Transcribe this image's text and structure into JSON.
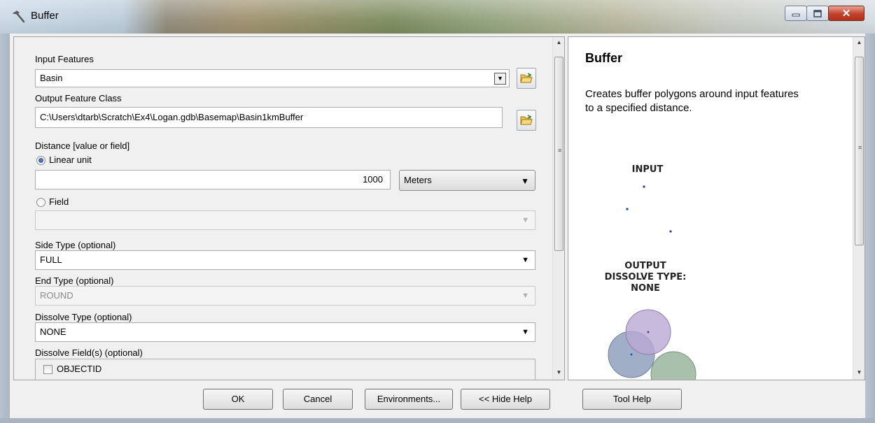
{
  "window": {
    "title": "Buffer"
  },
  "form": {
    "input_features": {
      "label": "Input Features",
      "value": "Basin"
    },
    "output_feature_class": {
      "label": "Output Feature Class",
      "value": "C:\\Users\\dtarb\\Scratch\\Ex4\\Logan.gdb\\Basemap\\Basin1kmBuffer"
    },
    "distance": {
      "label": "Distance [value or field]",
      "linear_unit_label": "Linear unit",
      "linear_unit_selected": true,
      "value": "1000",
      "unit": "Meters",
      "field_label": "Field",
      "field_value": ""
    },
    "side_type": {
      "label": "Side Type (optional)",
      "value": "FULL"
    },
    "end_type": {
      "label": "End Type (optional)",
      "value": "ROUND"
    },
    "dissolve_type": {
      "label": "Dissolve Type (optional)",
      "value": "NONE"
    },
    "dissolve_fields": {
      "label": "Dissolve Field(s) (optional)",
      "items": [
        {
          "label": "OBJECTID",
          "checked": false
        }
      ]
    }
  },
  "help": {
    "title": "Buffer",
    "description": "Creates buffer polygons around input features to a specified distance.",
    "diagram": {
      "input_label": "INPUT",
      "output_line1": "OUTPUT",
      "output_line2": "DISSOLVE TYPE:",
      "output_line3": "NONE"
    }
  },
  "buttons": {
    "ok": "OK",
    "cancel": "Cancel",
    "environments": "Environments...",
    "hide_help": "<< Hide Help",
    "tool_help": "Tool Help"
  },
  "colors": {
    "circle_purple": "#b9a9d3",
    "circle_blue": "#8fa0bd",
    "circle_green": "#9ab59e",
    "point_blue": "#1f3fae"
  }
}
